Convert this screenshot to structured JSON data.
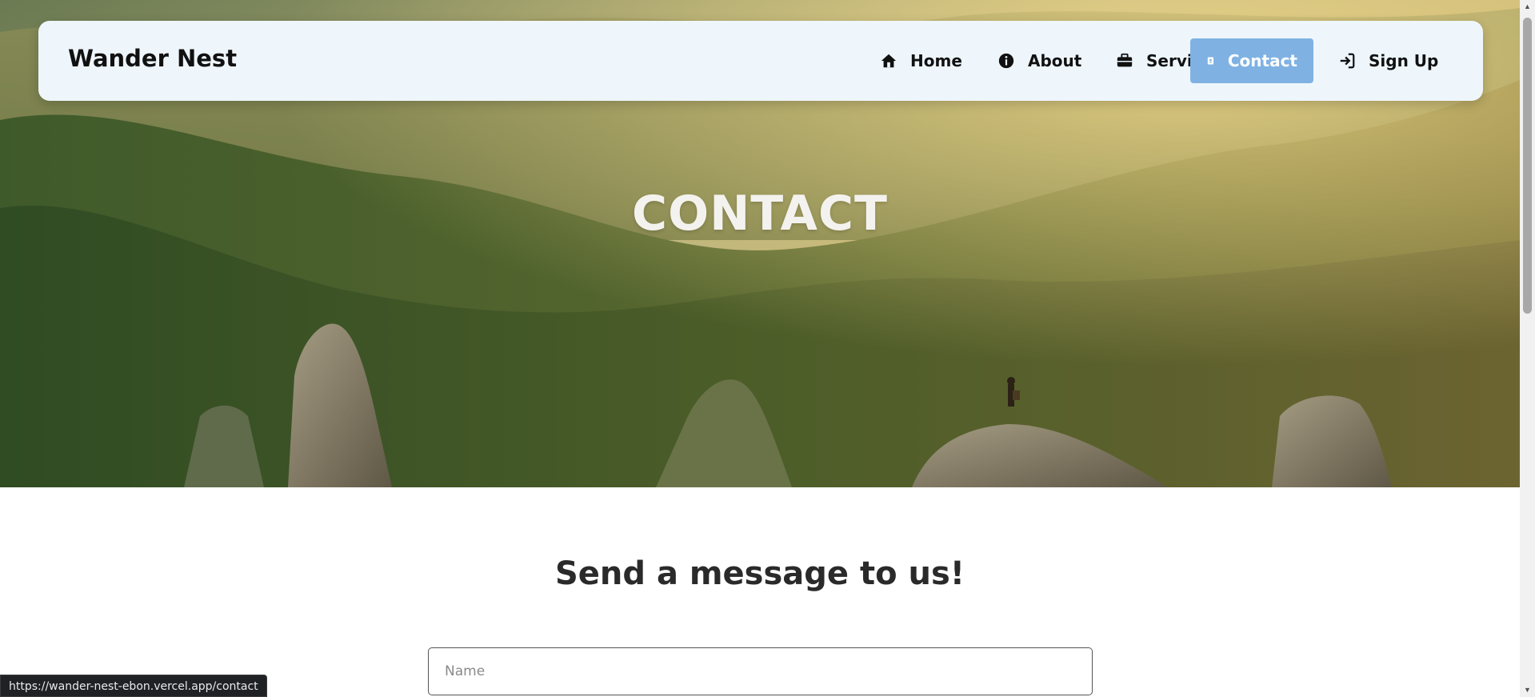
{
  "brand": "Wander Nest",
  "nav": {
    "home": "Home",
    "about": "About",
    "service": "Service",
    "contact": "Contact",
    "signup": "Sign Up"
  },
  "hero": {
    "title": "CONTACT"
  },
  "form": {
    "title": "Send a message to us!",
    "name_placeholder": "Name"
  },
  "status_url": "https://wander-nest-ebon.vercel.app/contact",
  "colors": {
    "nav_bg": "#eef6fc",
    "active_bg": "#7fb2e3",
    "text": "#111111"
  }
}
